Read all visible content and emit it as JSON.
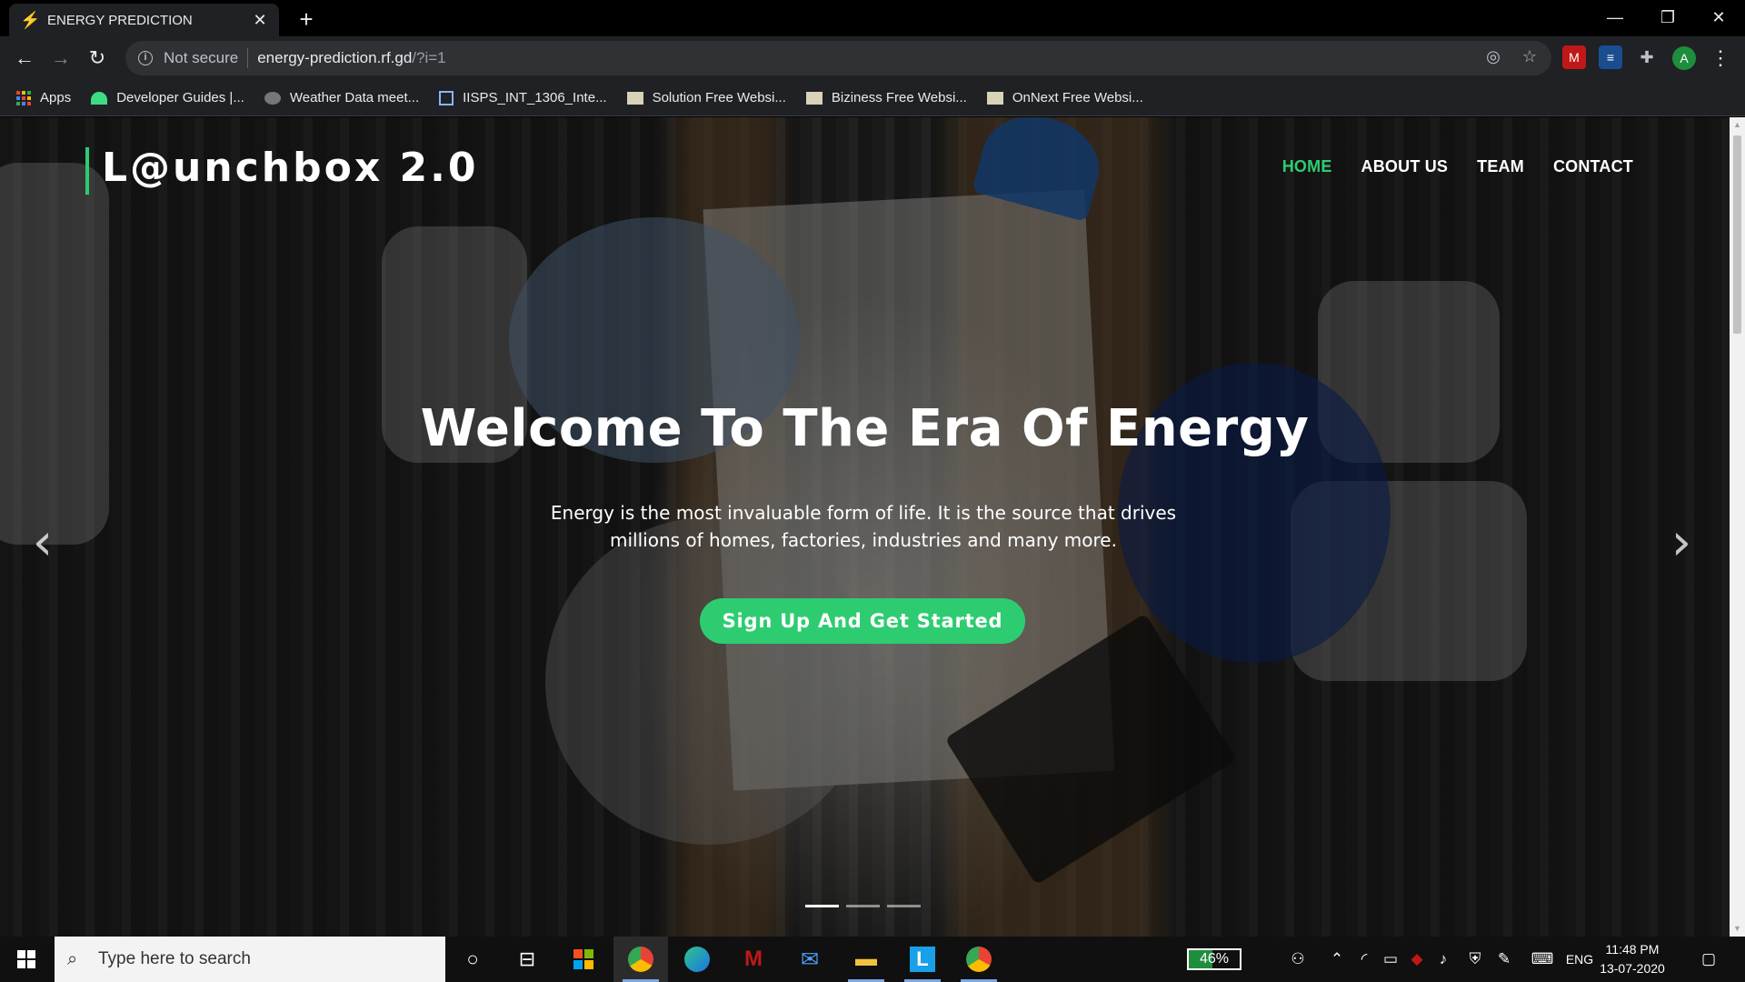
{
  "browser": {
    "tab_title": "ENERGY PREDICTION",
    "favicon": "lightning-icon",
    "url_status": "Not secure",
    "url_host": "energy-prediction.rf.gd",
    "url_path": "/?i=1",
    "profile_initial": "A",
    "bookmarks": [
      {
        "label": "Apps",
        "icon": "apps-grid-icon"
      },
      {
        "label": "Developer Guides |...",
        "icon": "android-icon"
      },
      {
        "label": "Weather Data meet...",
        "icon": "weather-icon"
      },
      {
        "label": "IISPS_INT_1306_Inte...",
        "icon": "document-icon"
      },
      {
        "label": "Solution Free Websi...",
        "icon": "page-icon"
      },
      {
        "label": "Biziness Free Websi...",
        "icon": "page-icon"
      },
      {
        "label": "OnNext Free Websi...",
        "icon": "page-icon"
      }
    ]
  },
  "site": {
    "brand": "L@unchbox 2.0",
    "nav": [
      "HOME",
      "ABOUT US",
      "TEAM",
      "CONTACT"
    ],
    "active_nav": "HOME",
    "headline": "Welcome To The Era Of Energy",
    "subtext_line1": "Energy is the most invaluable form of life. It is the source that drives",
    "subtext_line2": "millions of homes, factories, industries and many more.",
    "cta": "Sign Up And Get Started",
    "prev_arrow": "‹",
    "next_arrow": "›",
    "slides_total": 3,
    "slide_active": 1,
    "accent_color": "#2ecc71"
  },
  "taskbar": {
    "search_placeholder": "Type here to search",
    "battery": "46%",
    "battery_level": 0.46,
    "language": "ENG",
    "time": "11:48 PM",
    "date": "13-07-2020"
  }
}
